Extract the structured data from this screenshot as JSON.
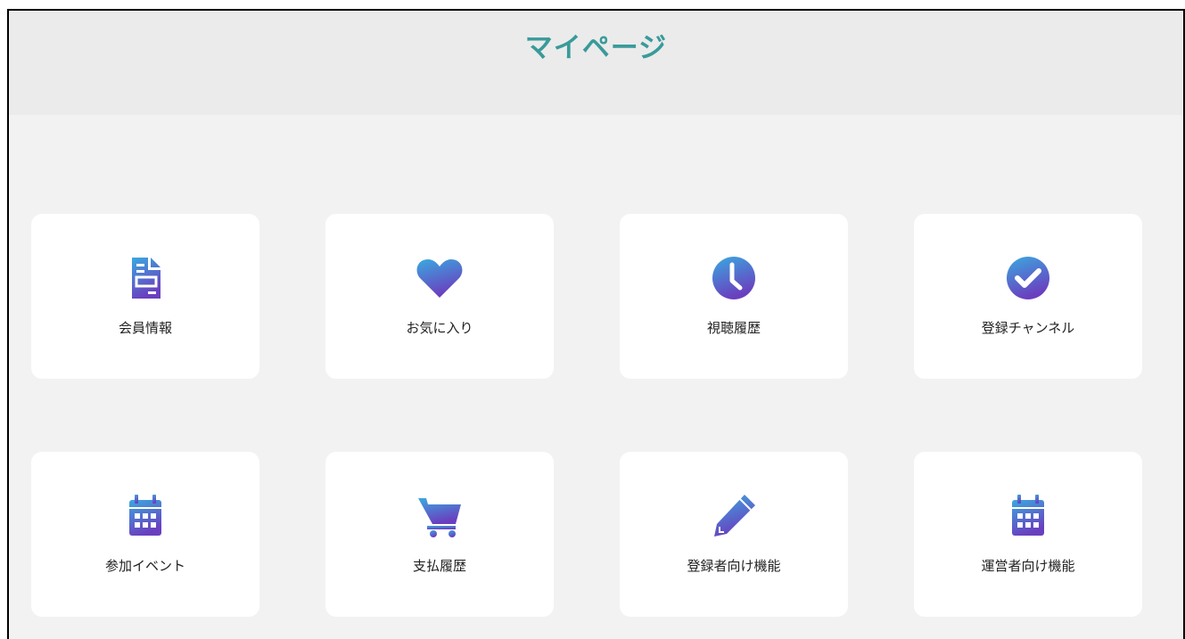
{
  "page": {
    "title": "マイページ"
  },
  "colors": {
    "title": "#3a9a9a",
    "header_bg": "#ebebeb",
    "main_bg": "#f2f2f2",
    "card_bg": "#ffffff",
    "icon_gradient_top": "#3aa9e0",
    "icon_gradient_bottom": "#6a3fbf"
  },
  "menu": {
    "items": [
      {
        "label": "会員情報",
        "icon": "document-icon"
      },
      {
        "label": "お気に入り",
        "icon": "heart-icon"
      },
      {
        "label": "視聴履歴",
        "icon": "clock-icon"
      },
      {
        "label": "登録チャンネル",
        "icon": "check-circle-icon"
      },
      {
        "label": "参加イベント",
        "icon": "calendar-icon"
      },
      {
        "label": "支払履歴",
        "icon": "cart-icon"
      },
      {
        "label": "登録者向け機能",
        "icon": "pencil-icon"
      },
      {
        "label": "運営者向け機能",
        "icon": "calendar-icon"
      }
    ]
  }
}
